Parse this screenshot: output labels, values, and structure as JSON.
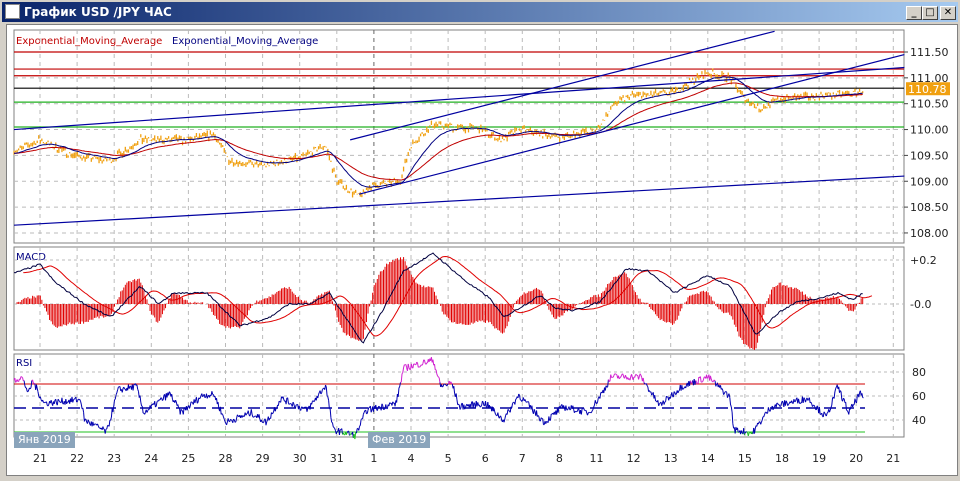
{
  "window": {
    "title": "График USD /JPY  ЧАС",
    "buttons": [
      "minimize",
      "maximize",
      "close"
    ]
  },
  "legend": {
    "ema_red": "Exponential_Moving_Average",
    "ema_blue": "Exponential_Moving_Average"
  },
  "colors": {
    "price": "#f0a010",
    "ema_slow": "#c00000",
    "ema_fast": "#000080",
    "trend": "#0000a0",
    "resistance": "#c00000",
    "support": "#20b020",
    "current": "#000000"
  },
  "chart_data": [
    {
      "type": "line",
      "title": "",
      "current_price": "110.78",
      "y_ticks": [
        "111.50",
        "111.00",
        "110.50",
        "110.00",
        "109.50",
        "109.00",
        "108.50",
        "108.00"
      ],
      "ylim": [
        107.9,
        111.9
      ],
      "x_ticks": [
        "21",
        "22",
        "23",
        "24",
        "25",
        "28",
        "29",
        "30",
        "31",
        "1",
        "4",
        "5",
        "6",
        "7",
        "8",
        "11",
        "12",
        "13",
        "14",
        "15",
        "18",
        "19",
        "20",
        "21"
      ],
      "month_labels": [
        "Янв 2019",
        "Фев 2019"
      ],
      "price": [
        [
          -0.6,
          109.6
        ],
        [
          0,
          109.8
        ],
        [
          0.9,
          109.5
        ],
        [
          1.9,
          109.4
        ],
        [
          2.7,
          109.8
        ],
        [
          4.0,
          109.8
        ],
        [
          4.7,
          109.9
        ],
        [
          5.1,
          109.4
        ],
        [
          6.0,
          109.3
        ],
        [
          7.0,
          109.45
        ],
        [
          7.7,
          109.7
        ],
        [
          8.0,
          109.0
        ],
        [
          8.6,
          108.7
        ],
        [
          8.9,
          108.9
        ],
        [
          9.7,
          109.0
        ],
        [
          10.0,
          109.7
        ],
        [
          10.6,
          110.1
        ],
        [
          11.9,
          110.0
        ],
        [
          12.4,
          109.8
        ],
        [
          13.0,
          110.0
        ],
        [
          14.0,
          109.85
        ],
        [
          15.0,
          110.0
        ],
        [
          15.5,
          110.5
        ],
        [
          15.9,
          110.65
        ],
        [
          17.0,
          110.7
        ],
        [
          18.0,
          111.1
        ],
        [
          18.6,
          111.0
        ],
        [
          19.0,
          110.6
        ],
        [
          19.4,
          110.4
        ],
        [
          20.0,
          110.6
        ],
        [
          20.9,
          110.65
        ],
        [
          22.0,
          110.7
        ],
        [
          22.2,
          110.78
        ]
      ],
      "horizontal_levels": [
        {
          "value": 111.5,
          "color": "#c00000"
        },
        {
          "value": 111.17,
          "color": "#c00000"
        },
        {
          "value": 111.04,
          "color": "#c00000"
        },
        {
          "value": 110.8,
          "color": "#000000"
        },
        {
          "value": 110.53,
          "color": "#20b020"
        },
        {
          "value": 110.05,
          "color": "#20b020"
        }
      ],
      "trend_lines": [
        [
          [
            -0.7,
            110.0
          ],
          [
            23.3,
            111.2
          ]
        ],
        [
          [
            8.36,
            109.8
          ],
          [
            19.8,
            111.9
          ]
        ],
        [
          [
            8.6,
            108.75
          ],
          [
            23.3,
            111.45
          ]
        ],
        [
          [
            -0.7,
            108.15
          ],
          [
            23.3,
            109.1
          ]
        ]
      ]
    },
    {
      "type": "line",
      "title": "MACD",
      "y_ticks": [
        "+0.2",
        "-0.0"
      ],
      "macd": [
        [
          -0.7,
          0.14
        ],
        [
          0,
          0.18
        ],
        [
          0.4,
          0.1
        ],
        [
          1.2,
          0
        ],
        [
          1.9,
          -0.06
        ],
        [
          2.7,
          0.08
        ],
        [
          3.2,
          0
        ],
        [
          3.6,
          0.05
        ],
        [
          4.5,
          0.05
        ],
        [
          5.4,
          -0.1
        ],
        [
          6.2,
          -0.06
        ],
        [
          6.7,
          0
        ],
        [
          7.3,
          0
        ],
        [
          7.8,
          0.05
        ],
        [
          8.7,
          -0.18
        ],
        [
          9.2,
          -0.04
        ],
        [
          9.8,
          0.15
        ],
        [
          10.6,
          0.23
        ],
        [
          11.5,
          0.1
        ],
        [
          12.1,
          0.03
        ],
        [
          12.5,
          -0.06
        ],
        [
          13.5,
          0.04
        ],
        [
          13.9,
          -0.02
        ],
        [
          14.4,
          -0.03
        ],
        [
          15.1,
          0.01
        ],
        [
          15.8,
          0.16
        ],
        [
          16.4,
          0.15
        ],
        [
          17.1,
          0.05
        ],
        [
          18.0,
          0.13
        ],
        [
          18.6,
          0.08
        ],
        [
          19.3,
          -0.14
        ],
        [
          19.9,
          -0.04
        ],
        [
          20.4,
          0.01
        ],
        [
          21.1,
          0.03
        ],
        [
          21.5,
          0.05
        ],
        [
          21.9,
          0.02
        ],
        [
          22.2,
          0.05
        ]
      ]
    },
    {
      "type": "line",
      "title": "RSI",
      "y_ticks": [
        "80",
        "60",
        "40"
      ],
      "levels": {
        "overbought": 70,
        "middle": 50,
        "oversold": 30
      },
      "rsi": [
        [
          -0.7,
          73
        ],
        [
          -0.5,
          76
        ],
        [
          -0.3,
          62
        ],
        [
          -0.2,
          73
        ],
        [
          0.1,
          54
        ],
        [
          1.1,
          57
        ],
        [
          1.2,
          40
        ],
        [
          1.8,
          30
        ],
        [
          2.1,
          65
        ],
        [
          2.6,
          68
        ],
        [
          2.8,
          46
        ],
        [
          3.5,
          62
        ],
        [
          3.8,
          46
        ],
        [
          4.4,
          61
        ],
        [
          4.7,
          61
        ],
        [
          5.0,
          38
        ],
        [
          5.7,
          46
        ],
        [
          6.1,
          38
        ],
        [
          6.5,
          58
        ],
        [
          7.2,
          48
        ],
        [
          7.7,
          69
        ],
        [
          7.9,
          32
        ],
        [
          8.5,
          27
        ],
        [
          8.8,
          48
        ],
        [
          9.6,
          54
        ],
        [
          9.8,
          83
        ],
        [
          10.6,
          90
        ],
        [
          10.8,
          68
        ],
        [
          11.1,
          71
        ],
        [
          11.3,
          51
        ],
        [
          12.0,
          54
        ],
        [
          12.5,
          40
        ],
        [
          12.9,
          61
        ],
        [
          13.6,
          38
        ],
        [
          14.1,
          51
        ],
        [
          14.8,
          46
        ],
        [
          15.2,
          65
        ],
        [
          15.4,
          76
        ],
        [
          16.2,
          76
        ],
        [
          16.7,
          52
        ],
        [
          17.3,
          68
        ],
        [
          18.0,
          76
        ],
        [
          18.6,
          59
        ],
        [
          18.7,
          32
        ],
        [
          19.2,
          29
        ],
        [
          19.7,
          51
        ],
        [
          20.7,
          58
        ],
        [
          21.2,
          42
        ],
        [
          21.5,
          68
        ],
        [
          21.8,
          46
        ],
        [
          22.1,
          62
        ],
        [
          22.2,
          57
        ]
      ]
    }
  ]
}
